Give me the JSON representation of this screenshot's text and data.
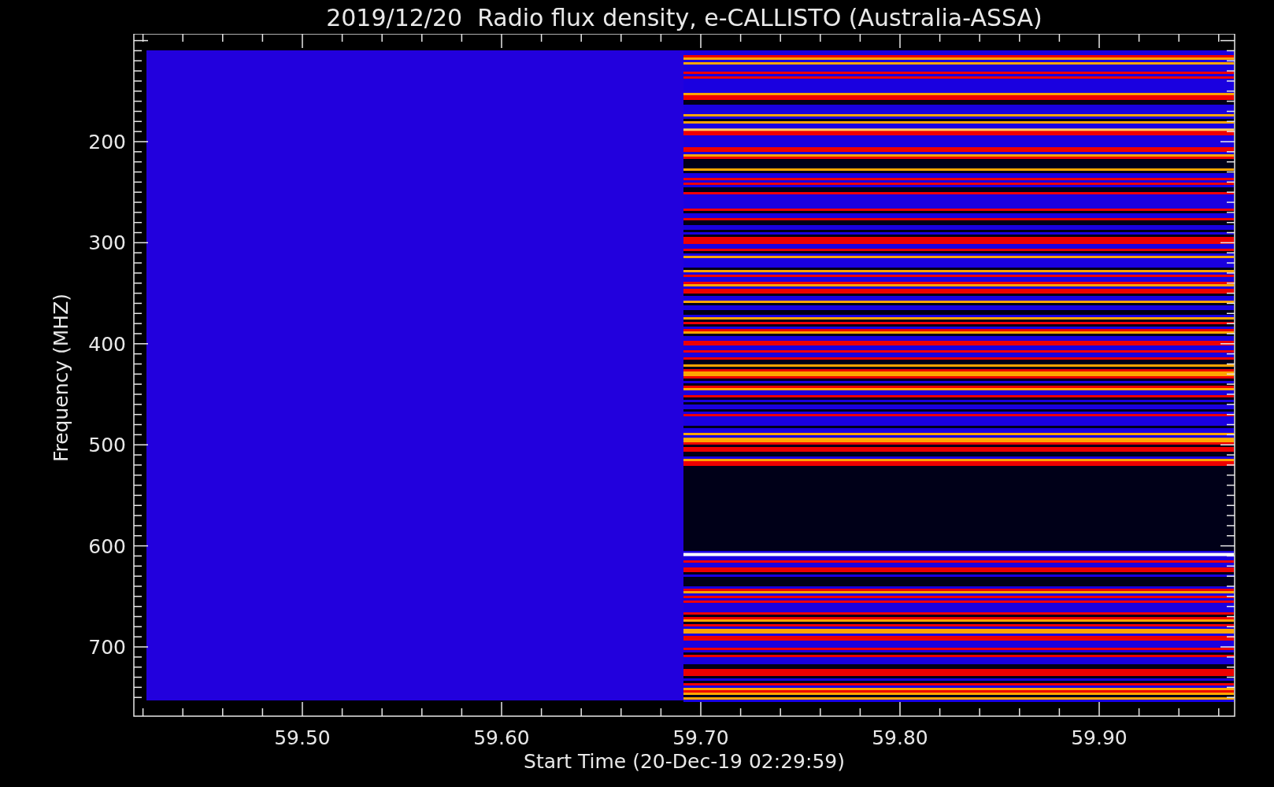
{
  "title": "2019/12/20  Radio flux density, e-CALLISTO (Australia-ASSA)",
  "y_axis": {
    "label": "Frequency (MHZ)",
    "ticks": [
      "200",
      "300",
      "400",
      "500",
      "600",
      "700"
    ]
  },
  "x_axis": {
    "label": "Start Time (20-Dec-19 02:29:59)",
    "ticks": [
      "59.50",
      "59.60",
      "59.70",
      "59.80",
      "59.90"
    ]
  }
}
